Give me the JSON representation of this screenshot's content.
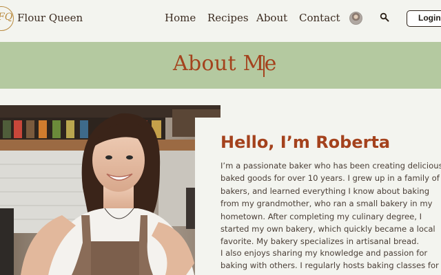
{
  "header": {
    "logo_mark": "FQ",
    "brand": "Flour Queen",
    "nav": {
      "home": "Home",
      "recipes": "Recipes",
      "about": "About",
      "contact": "Contact"
    },
    "login": "Login",
    "search_icon": "search-icon"
  },
  "banner": {
    "title": "About Me"
  },
  "about": {
    "greeting": "Hello, I’m Roberta",
    "paragraph1": "I’m a passionate baker who has been creating delicious baked goods for over 10 years. I grew up in a family of bakers, and learned everything I know about baking from my grandmother, who ran a small bakery in my hometown. After completing my culinary degree, I started my own bakery, which quickly became a local favorite. My bakery specializes in artisanal bread.",
    "paragraph2": "I also enjoys sharing my knowledge and passion for baking with others. I regularly hosts baking classes for both kids and adults, and loves to inspire others."
  },
  "colors": {
    "accent": "#a4421d",
    "banner_bg": "#b4c9a0",
    "page_bg": "#f3f4ef",
    "logo_gold": "#b8893d"
  }
}
